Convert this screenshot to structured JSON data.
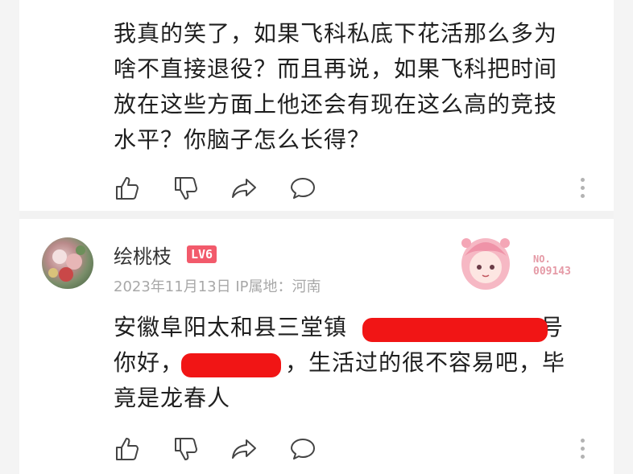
{
  "comment1": {
    "text_line1": "我真的笑了，如果飞科私底下花活那么多为",
    "text_line2": "啥不直接退役？而且再说，如果飞科把时间",
    "text_line3": "放在这些方面上他还会有现在这么高的竞技",
    "text_line4": "水平？你脑子怎么长得？"
  },
  "comment2": {
    "username": "绘桃枝",
    "level_badge": "LV6",
    "meta": "2023年11月13日 IP属地：河南",
    "decoration_no_label": "NO.",
    "decoration_number": "009143",
    "text_line1_visible": "安徽阜阳太和县三堂镇",
    "text_line1_tail": "号",
    "text_line2_prefix": "你好，",
    "text_line2_suffix": "，生活过的很不容易吧，毕",
    "text_line3": "竟是龙春人"
  },
  "icons": [
    "like-icon",
    "dislike-icon",
    "share-icon",
    "comment-icon",
    "more-icon"
  ],
  "colors": {
    "redaction": "#f11515",
    "level_badge": "#f25a6b",
    "meta_text": "#a8a8a8",
    "icon": "#444444"
  }
}
